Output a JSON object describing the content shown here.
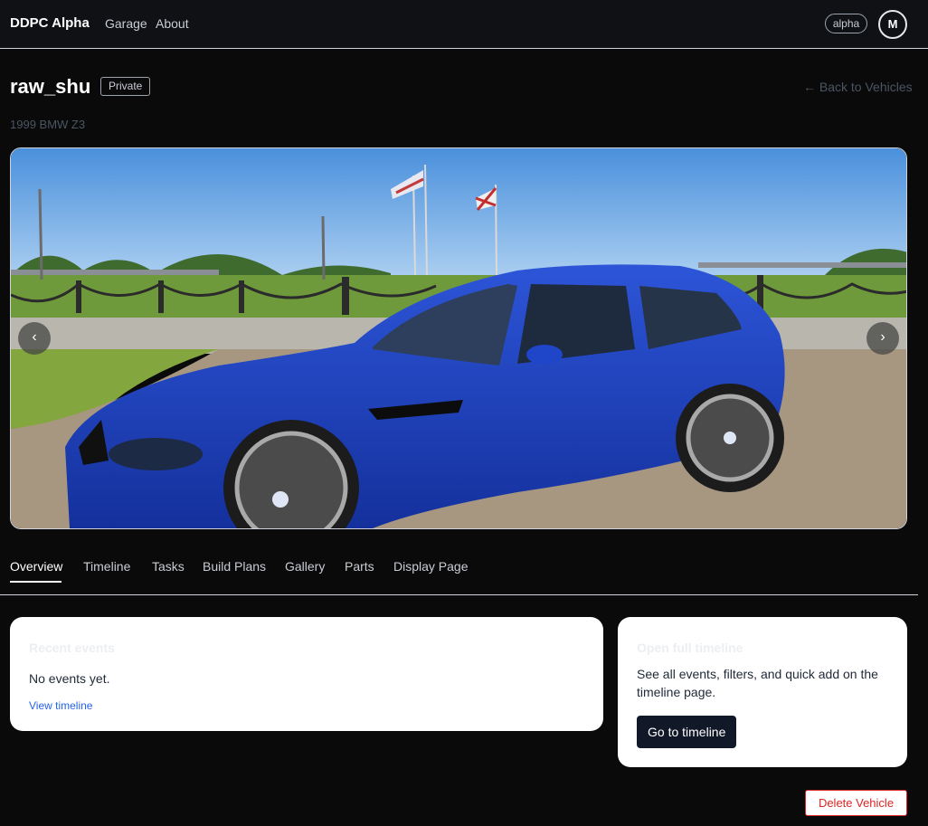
{
  "nav": {
    "brand": "DDPC Alpha",
    "links": [
      "Garage",
      "About"
    ],
    "badge": "alpha",
    "avatar_initial": "M"
  },
  "vehicle": {
    "name": "raw_shu",
    "visibility": "Private",
    "subtitle": "1999 BMW Z3",
    "back_link": "← Back to Vehicles"
  },
  "carousel": {
    "prev_label": "‹",
    "next_label": "›",
    "image_description_icon": "car-photo",
    "car_color": "#1d3fb8"
  },
  "tabs": [
    {
      "label": "Overview",
      "active": true
    },
    {
      "label": "Timeline",
      "active": false
    },
    {
      "label": "Tasks",
      "active": false
    },
    {
      "label": "Build Plans",
      "active": false
    },
    {
      "label": "Gallery",
      "active": false
    },
    {
      "label": "Parts",
      "active": false
    },
    {
      "label": "Display Page",
      "active": false
    }
  ],
  "recent_events": {
    "heading": "Recent events",
    "empty_text": "No events yet.",
    "link": "View timeline"
  },
  "full_timeline": {
    "heading": "Open full timeline",
    "description": "See all events, filters, and quick add on the timeline page.",
    "button": "Go to timeline"
  },
  "delete_button": "Delete Vehicle",
  "colors": {
    "background": "#0a0a0b",
    "nav_background": "#0f1115",
    "danger": "#dc2626",
    "link": "#2563eb",
    "primary_button": "#111827"
  }
}
